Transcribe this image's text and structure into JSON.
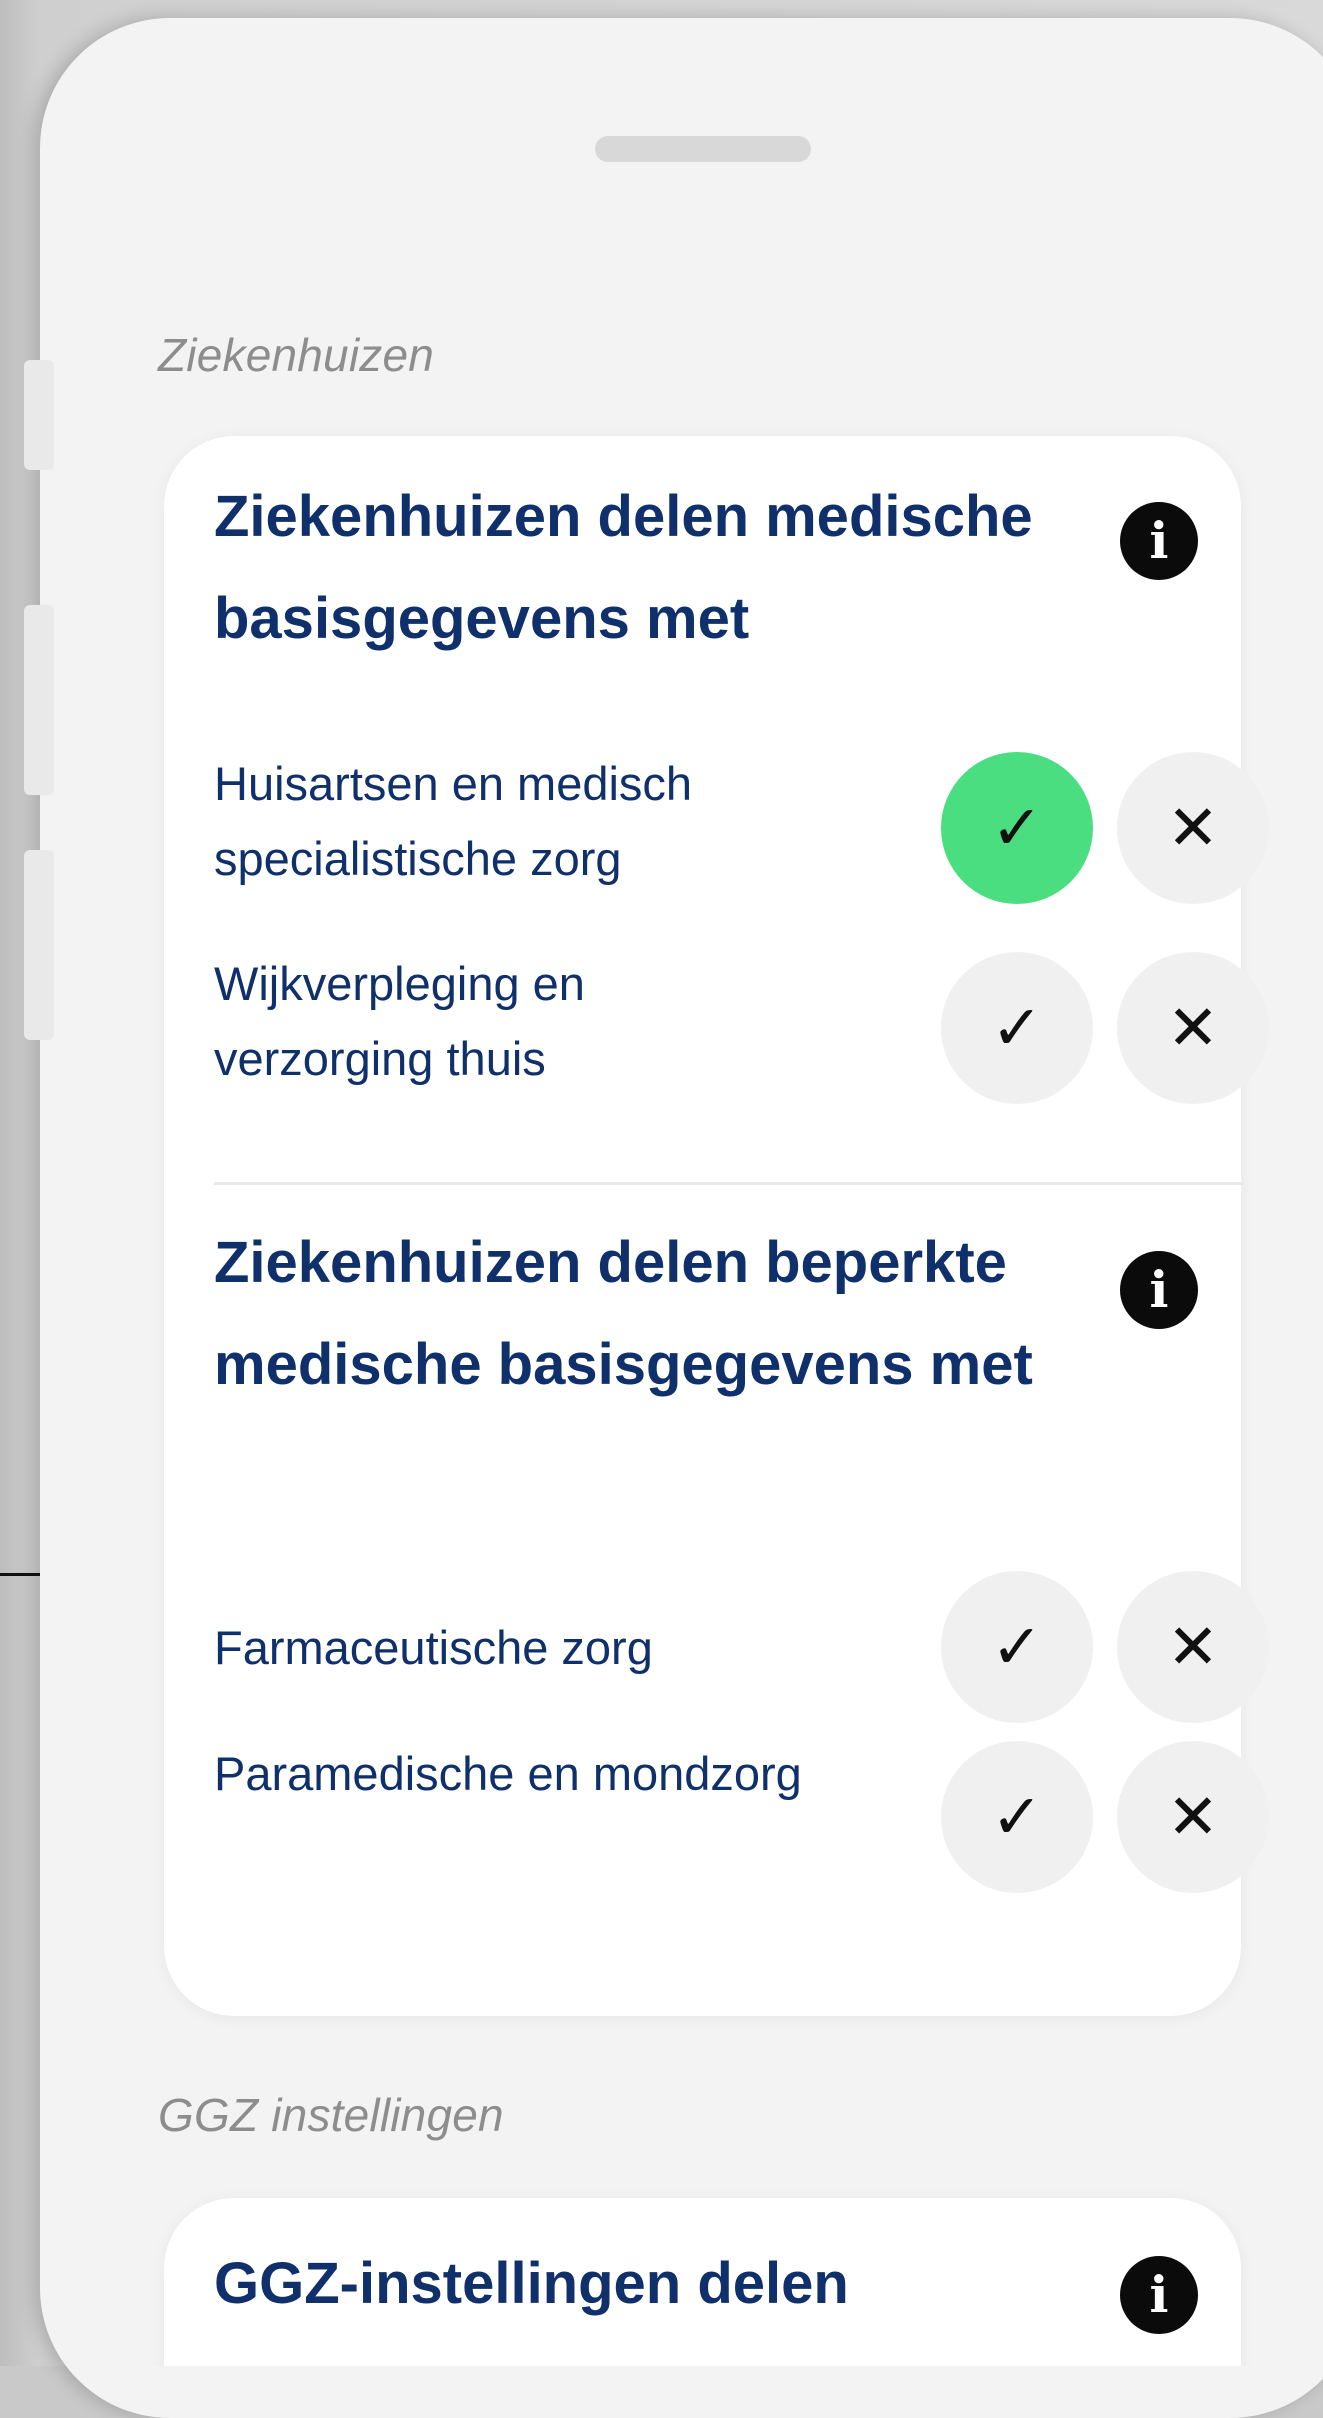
{
  "sheet": {
    "sections": [
      {
        "title": "Ziekenhuizen",
        "groups": [
          {
            "heading": "Ziekenhuizen delen medische basisgegevens met",
            "info_icon": "info-icon",
            "rows": [
              {
                "label": "Huisartsen en medisch specialistische zorg",
                "state": "yes"
              },
              {
                "label": "Wijkverpleging en verzorging thuis",
                "state": "none"
              }
            ]
          },
          {
            "heading": "Ziekenhuizen delen beperkte medische basisgegevens met",
            "info_icon": "info-icon",
            "rows": [
              {
                "label": "Farmaceutische zorg",
                "state": "none"
              },
              {
                "label": "Paramedische en mondzorg",
                "state": "none"
              }
            ]
          }
        ]
      },
      {
        "title": "GGZ instellingen",
        "groups": [
          {
            "heading": "GGZ-instellingen delen",
            "info_icon": "info-icon",
            "rows": []
          }
        ]
      }
    ]
  },
  "icons": {
    "check": "✓",
    "cross": "✕",
    "info": "i"
  },
  "colors": {
    "heading": "#10306b",
    "accept_active": "#4ade80",
    "section_title": "#8d8d8d"
  }
}
